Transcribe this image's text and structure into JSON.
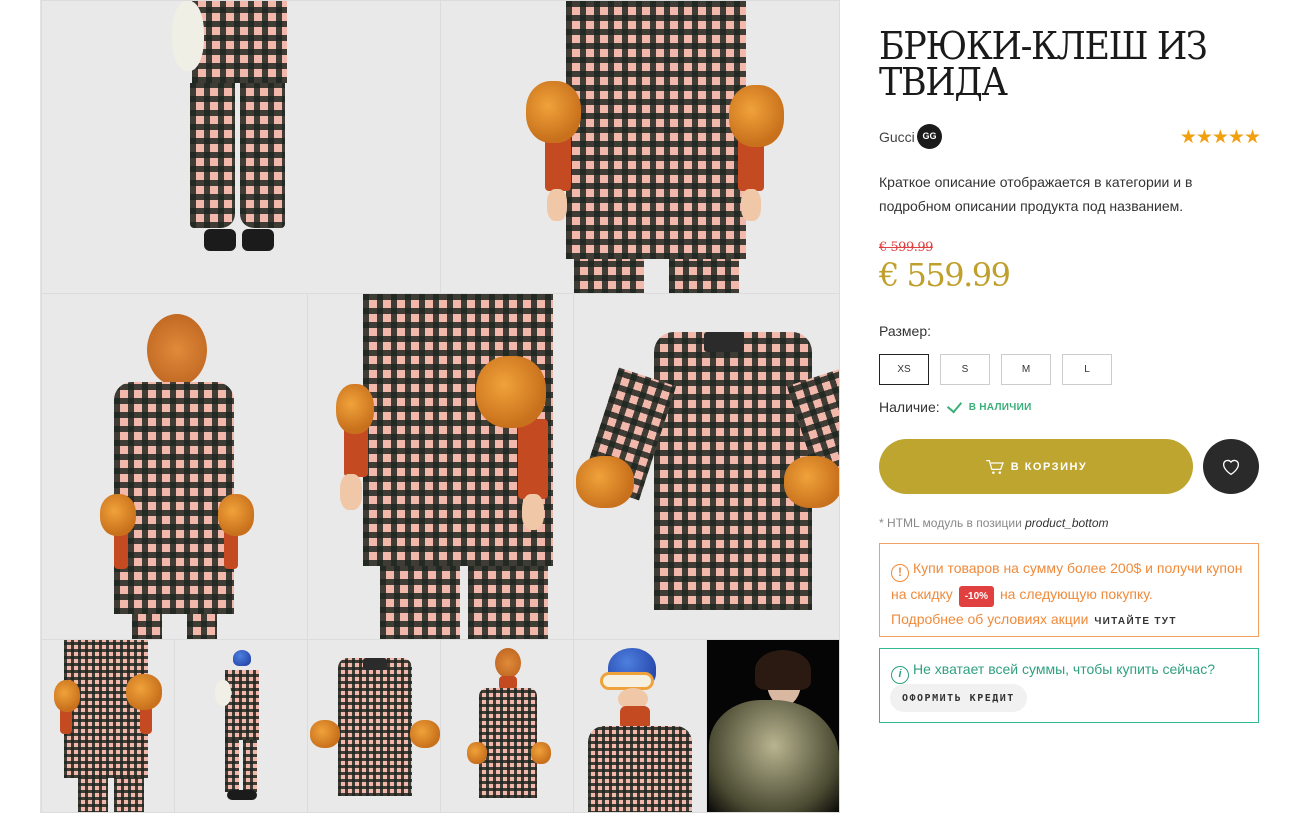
{
  "product": {
    "title": "БРЮКИ-КЛЕШ ИЗ ТВИДА",
    "brand": "Gucci",
    "brand_logo": "GG",
    "rating": 5,
    "stars": "★★★★★",
    "description": "Краткое описание отображается в категории и в подробном описании продукта под названием.",
    "old_price": "€ 599.99",
    "price": "€ 559.99"
  },
  "size": {
    "label": "Размер:",
    "options": [
      "XS",
      "S",
      "M",
      "L"
    ],
    "selected": "XS"
  },
  "availability": {
    "label": "Наличие:",
    "status": "В НАЛИЧИИ"
  },
  "actions": {
    "cart_label": "В КОРЗИНУ",
    "wishlist_icon": "heart-icon"
  },
  "html_module": {
    "prefix": "* HTML модуль в позиции",
    "position": "product_bottom"
  },
  "promo": {
    "text_1": "Купи товаров на сумму более 200$ и получи купон на скидку",
    "badge": "-10%",
    "text_2": "на следующую покупку.",
    "more_text": "Подробнее об условиях акции",
    "link": "ЧИТАЙТЕ ТУТ"
  },
  "credit": {
    "message": "Не хватает всей суммы, чтобы купить сейчас?",
    "button": "ОФОРМИТЬ КРЕДИТ"
  },
  "colors": {
    "gold": "#bda530",
    "price": "#c0a02c",
    "old_price": "#e04040",
    "promo_orange": "#f08a3a",
    "credit_green": "#30a080",
    "stars": "#f0a010"
  }
}
